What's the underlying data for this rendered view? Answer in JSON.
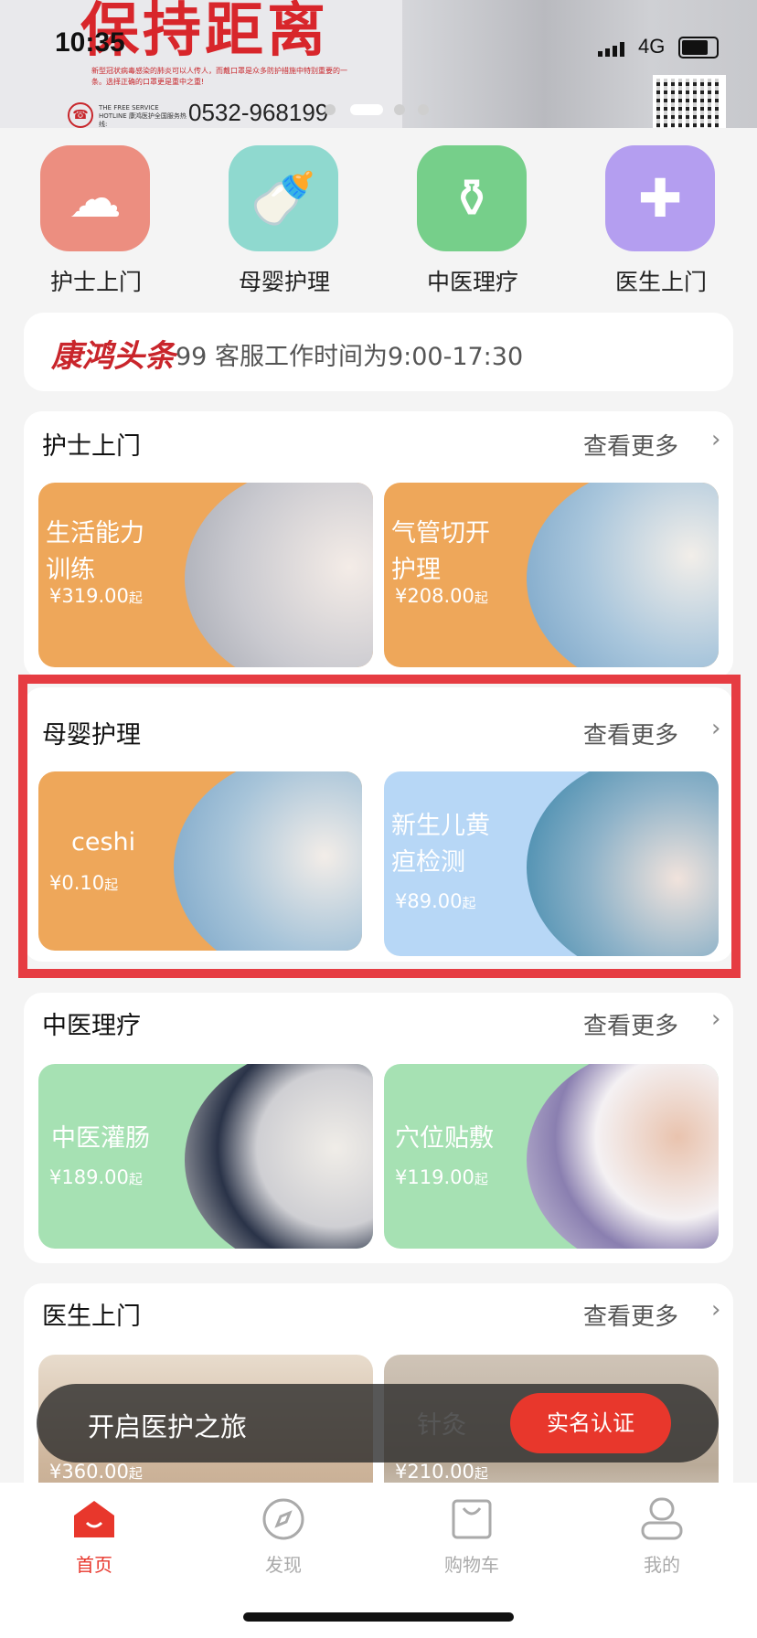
{
  "status": {
    "time": "10:35",
    "network": "4G"
  },
  "banner": {
    "title": "保持距离",
    "small_text": "新型冠状病毒感染的肺炎可以人传人，而戴口罩是众多防护措施中特别重要的一条。选择正确的口罩更是重中之重!",
    "hotline_label": "THE FREE SERVICE HOTLINE 康鸿医护全国服务热线:",
    "hotline_number": "0532-968199",
    "active_dot": 1
  },
  "categories": [
    {
      "label": "护士上门",
      "icon": "nurse-cap-icon",
      "color": "#ec8e80"
    },
    {
      "label": "母婴护理",
      "icon": "baby-bottle-icon",
      "color": "#8fd9cf"
    },
    {
      "label": "中医理疗",
      "icon": "herbal-bowl-icon",
      "color": "#76cf8a"
    },
    {
      "label": "医生上门",
      "icon": "doctor-icon",
      "color": "#b49ef0"
    }
  ],
  "notice": {
    "logo": "康鸿头条",
    "text": "99 客服工作时间为9:00-17:30"
  },
  "sections": [
    {
      "title": "护士上门",
      "more": "查看更多",
      "cards": [
        {
          "name": "生活能力训练",
          "price": "¥319.00",
          "suffix": "起"
        },
        {
          "name": "气管切开护理",
          "price": "¥208.00",
          "suffix": "起"
        }
      ]
    },
    {
      "title": "母婴护理",
      "more": "查看更多",
      "cards": [
        {
          "name": "ceshi",
          "price": "¥0.10",
          "suffix": "起"
        },
        {
          "name": "新生儿黄疸检测",
          "price": "¥89.00",
          "suffix": "起"
        }
      ]
    },
    {
      "title": "中医理疗",
      "more": "查看更多",
      "cards": [
        {
          "name": "中医灌肠",
          "price": "¥189.00",
          "suffix": "起"
        },
        {
          "name": "穴位贴敷",
          "price": "¥119.00",
          "suffix": "起"
        }
      ]
    },
    {
      "title": "医生上门",
      "more": "查看更多",
      "cards": [
        {
          "name": "",
          "price": "¥360.00",
          "suffix": "起"
        },
        {
          "name": "针灸",
          "price": "¥210.00",
          "suffix": "起"
        }
      ]
    }
  ],
  "floating_bar": {
    "text": "开启医护之旅",
    "button": "实名认证"
  },
  "tabs": [
    {
      "label": "首页",
      "icon": "home-icon",
      "active": true
    },
    {
      "label": "发现",
      "icon": "compass-icon",
      "active": false
    },
    {
      "label": "购物车",
      "icon": "shopping-bag-icon",
      "active": false
    },
    {
      "label": "我的",
      "icon": "profile-icon",
      "active": false
    }
  ],
  "colors": {
    "accent": "#e8372c",
    "highlight_border": "#e63c42",
    "orange_card": "#eea75a",
    "blue_card": "#b7d7f6",
    "green_card": "#a6e1b3"
  }
}
